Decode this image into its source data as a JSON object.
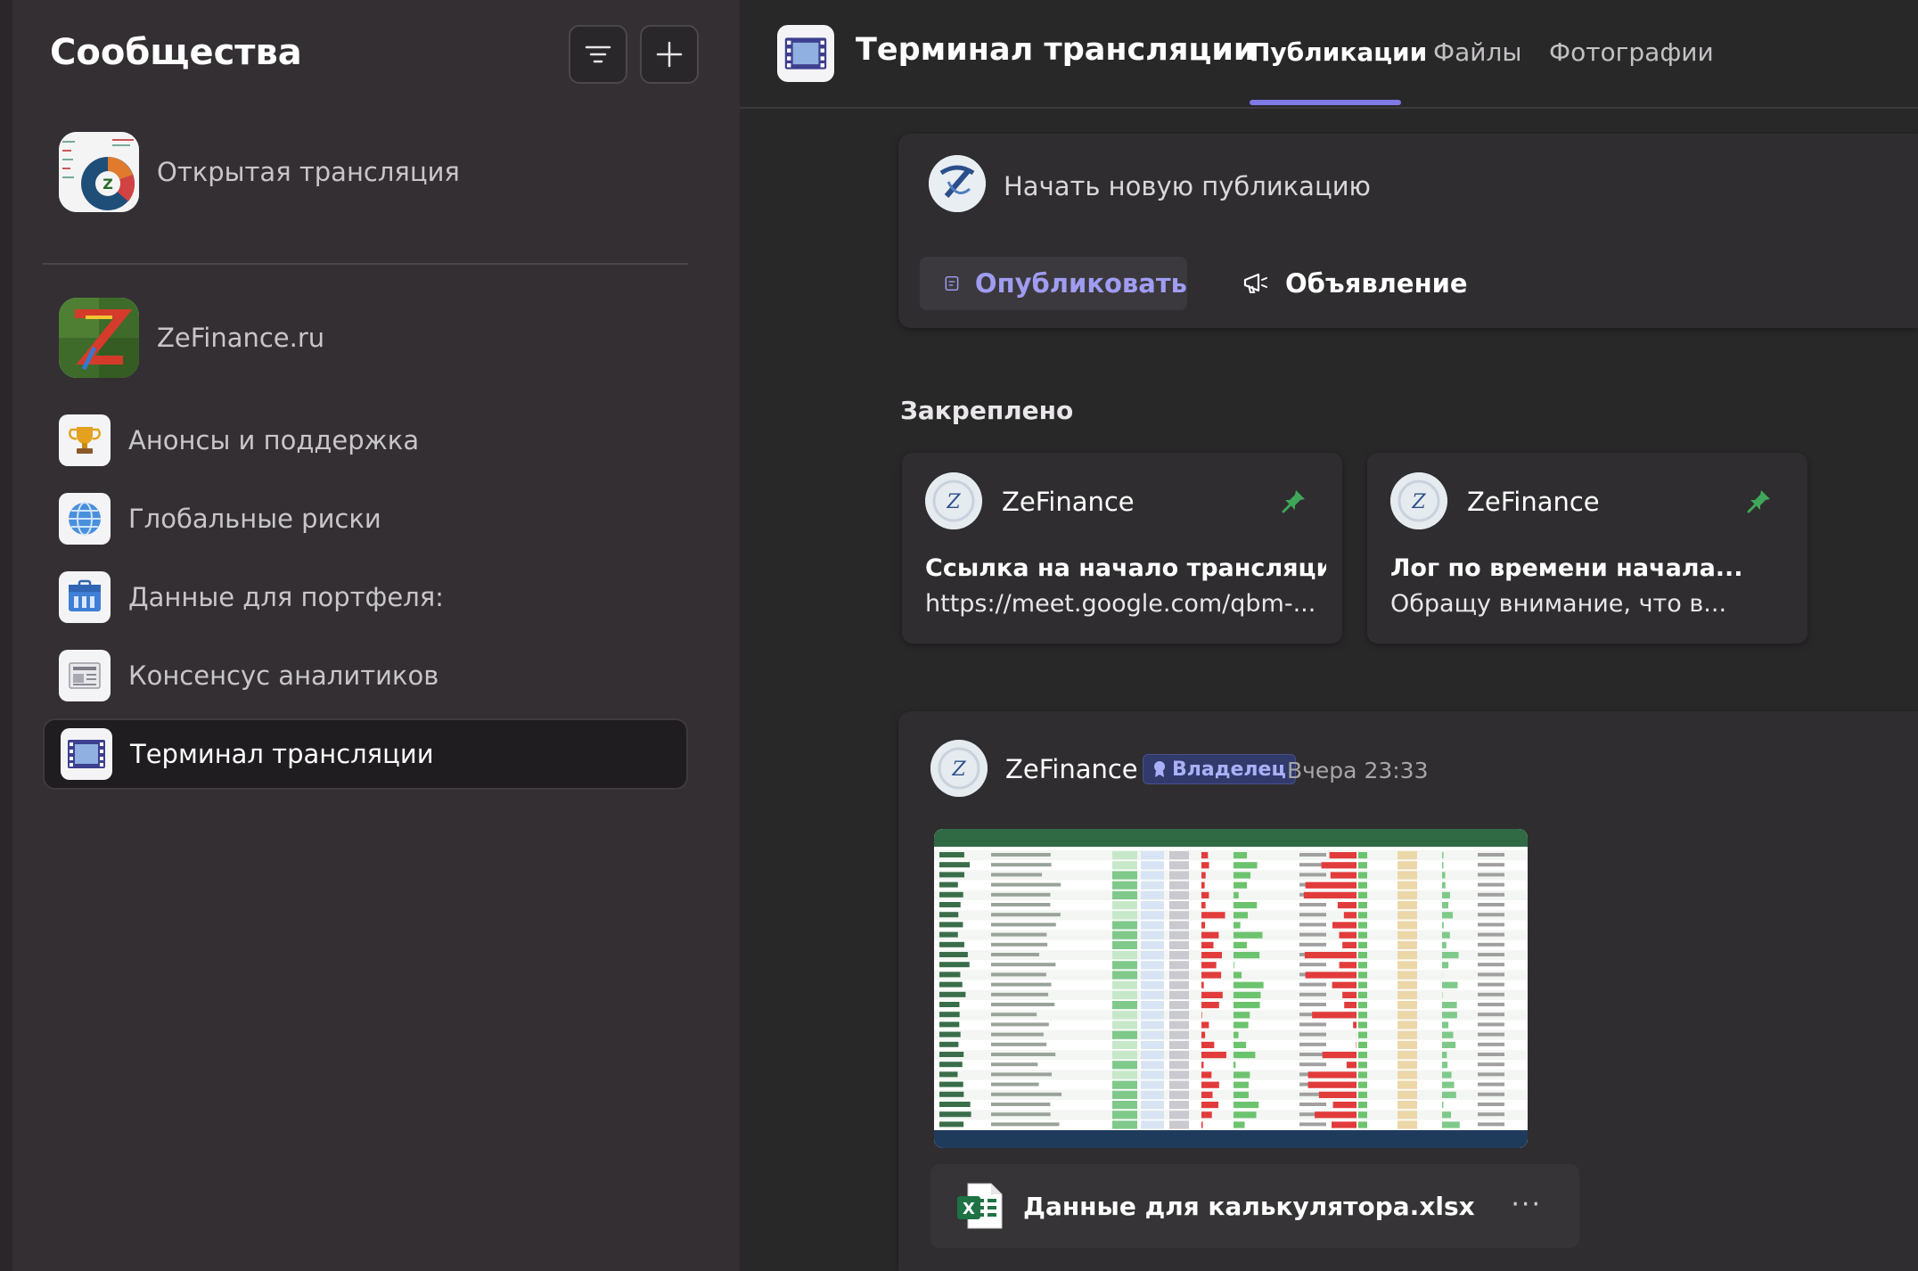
{
  "sidebar": {
    "title": "Сообщества",
    "communities": [
      {
        "label": "Открытая трансляция",
        "icon": "broadcast-chart-icon"
      },
      {
        "label": "ZeFinance.ru",
        "icon": "zefinance-logo-icon"
      }
    ],
    "channels": [
      {
        "label": "Анонсы и поддержка",
        "icon": "trophy-icon"
      },
      {
        "label": "Глобальные риски",
        "icon": "globe-icon"
      },
      {
        "label": "Данные для портфеля:",
        "icon": "briefcase-icon"
      },
      {
        "label": "Консенсус аналитиков",
        "icon": "document-icon"
      },
      {
        "label": "Терминал трансляции",
        "icon": "film-icon",
        "active": true
      }
    ]
  },
  "header": {
    "title": "Терминал трансляции",
    "tabs": [
      {
        "label": "Публикации",
        "active": true
      },
      {
        "label": "Файлы"
      },
      {
        "label": "Фотографии"
      }
    ]
  },
  "composer": {
    "placeholder": "Начать новую публикацию",
    "publish_label": "Опубликовать",
    "announce_label": "Объявление"
  },
  "pinned": {
    "title": "Закреплено",
    "items": [
      {
        "author": "ZeFinance",
        "title": "Ссылка на начало трансляци...",
        "body": "https://meet.google.com/qbm-..."
      },
      {
        "author": "ZeFinance",
        "title": "Лог по времени начала...",
        "body": "Обращу внимание, что в..."
      }
    ]
  },
  "post": {
    "author": "ZeFinance",
    "badge": "Владелец",
    "time": "Вчера 23:33",
    "file_name": "Данные для калькулятора.xlsx"
  },
  "colors": {
    "accent": "#7f7ae8",
    "publish_text": "#9f9cf2",
    "pin": "#3fa65a",
    "badge_bg": "#313a6a",
    "excel": "#1f7244"
  }
}
